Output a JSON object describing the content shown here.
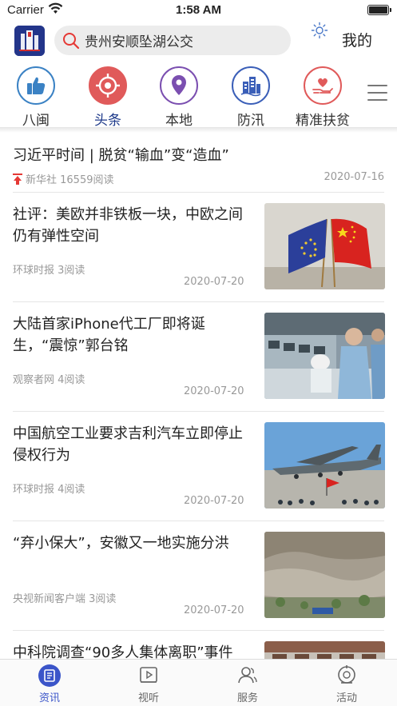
{
  "status_bar": {
    "carrier": "Carrier",
    "time": "1:58 AM"
  },
  "header": {
    "search_value": "贵州安顺坠湖公交",
    "mine_label": "我的"
  },
  "categories": [
    {
      "label": "八闽",
      "color": "#3b82c4"
    },
    {
      "label": "头条",
      "color": "#e05a5a",
      "active": true
    },
    {
      "label": "本地",
      "color": "#7b4fb0"
    },
    {
      "label": "防汛",
      "color": "#3b5fb8"
    },
    {
      "label": "精准扶贫",
      "color": "#e05a5a"
    }
  ],
  "top_article": {
    "title": "习近平时间 | 脱贫“输血”变“造血”",
    "meta": "新华社 16559阅读",
    "date": "2020-07-16"
  },
  "articles": [
    {
      "title": "社评：美欧并非铁板一块，中欧之间仍有弹性空间",
      "source": "环球时报  3阅读",
      "date": "2020-07-20"
    },
    {
      "title": "大陆首家iPhone代工厂即将诞生，“震惊”郭台铭",
      "source": "观察者网  4阅读",
      "date": "2020-07-20"
    },
    {
      "title": "中国航空工业要求吉利汽车立即停止侵权行为",
      "source": "环球时报  4阅读",
      "date": "2020-07-20"
    },
    {
      "title": "“弃小保大”，安徽又一地实施分洪",
      "source": "央视新闻客户端  3阅读",
      "date": "2020-07-20"
    },
    {
      "title": "中科院调查“90多人集体离职”事件",
      "source": "",
      "date": ""
    }
  ],
  "tabs": [
    {
      "label": "资讯",
      "active": true
    },
    {
      "label": "视听"
    },
    {
      "label": "服务"
    },
    {
      "label": "活动"
    }
  ],
  "colors": {
    "accent": "#3b55c9",
    "active_category": "#1e3a8a",
    "pin": "#e53935"
  }
}
